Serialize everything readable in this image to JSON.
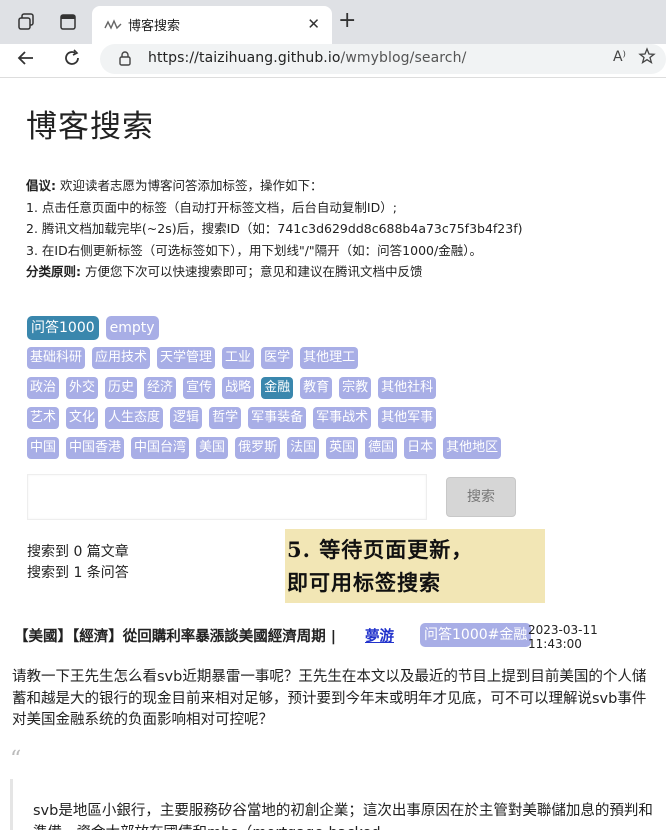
{
  "browser": {
    "tab_title": "博客搜索",
    "tab_close": "✕",
    "new_tab": "+",
    "url_host": "https://taizihuang.github.io",
    "url_path": "/wmyblog/search/",
    "read_aloud": "A⁾"
  },
  "page": {
    "title": "博客搜索",
    "notice": {
      "l1_label": "倡议:",
      "l1_text": "欢迎读者志愿为博客问答添加标签，操作如下：",
      "l2": "1. 点击任意页面中的标签（自动打开标签文档，后台自动复制ID）;",
      "l3": "2. 腾讯文档加载完毕(~2s)后，搜索ID（如：741c3d629dd8c688b4a73c75f3b4f23f)",
      "l4": "3. 在ID右侧更新标签（可选标签如下），用下划线\"/\"隔开（如：问答1000/金融）。",
      "l5_label": "分类原则:",
      "l5_text": "方便您下次可以快速搜索即可；意见和建议在腾讯文档中反馈"
    },
    "tags_row1": [
      "问答1000",
      "empty"
    ],
    "tags_row2": [
      "基础科研",
      "应用技术",
      "天学管理",
      "工业",
      "医学",
      "其他理工"
    ],
    "tags_row3": [
      "政治",
      "外交",
      "历史",
      "经济",
      "宣传",
      "战略",
      "金融",
      "教育",
      "宗教",
      "其他社科"
    ],
    "tags_row4": [
      "艺术",
      "文化",
      "人生态度",
      "逻辑",
      "哲学",
      "军事装备",
      "军事战术",
      "其他军事"
    ],
    "tags_row5": [
      "中国",
      "中国香港",
      "中国台湾",
      "美国",
      "俄罗斯",
      "法国",
      "英国",
      "德国",
      "日本",
      "其他地区"
    ],
    "search_button": "搜索",
    "search_placeholder": "",
    "count_articles": "搜索到 0 篇文章",
    "count_qa": "搜索到 1 条问答",
    "overlay_line1": "5. 等待页面更新，",
    "overlay_line2": "即可用标签搜索"
  },
  "result": {
    "title": "【美國】【經濟】從回購利率暴漲談美國經濟周期 |",
    "author": "夢游",
    "tag": "问答1000#金融",
    "date": "2023-03-11 11:43:00",
    "question": "请教一下王先生怎么看svb近期暴雷一事呢？王先生在本文以及最近的节目上提到目前美国的个人储蓄和越是大的银行的现金目前来相对足够，预计要到今年末或明年才见底，可不可以理解说svb事件对美国金融系统的负面影响相对可控呢？",
    "quote_mark": "“",
    "answer": "svb是地區小銀行，主要服務矽谷當地的初創企業；這次出事原因在於主管對美聯儲加息的預判和準備，資金大部放在國債和mbs（mortgage-backed"
  },
  "colors": {
    "tag": "#a8aee6",
    "tag_active": "#3a87ad",
    "overlay": "#f2e6b5",
    "link": "#2233cc"
  }
}
